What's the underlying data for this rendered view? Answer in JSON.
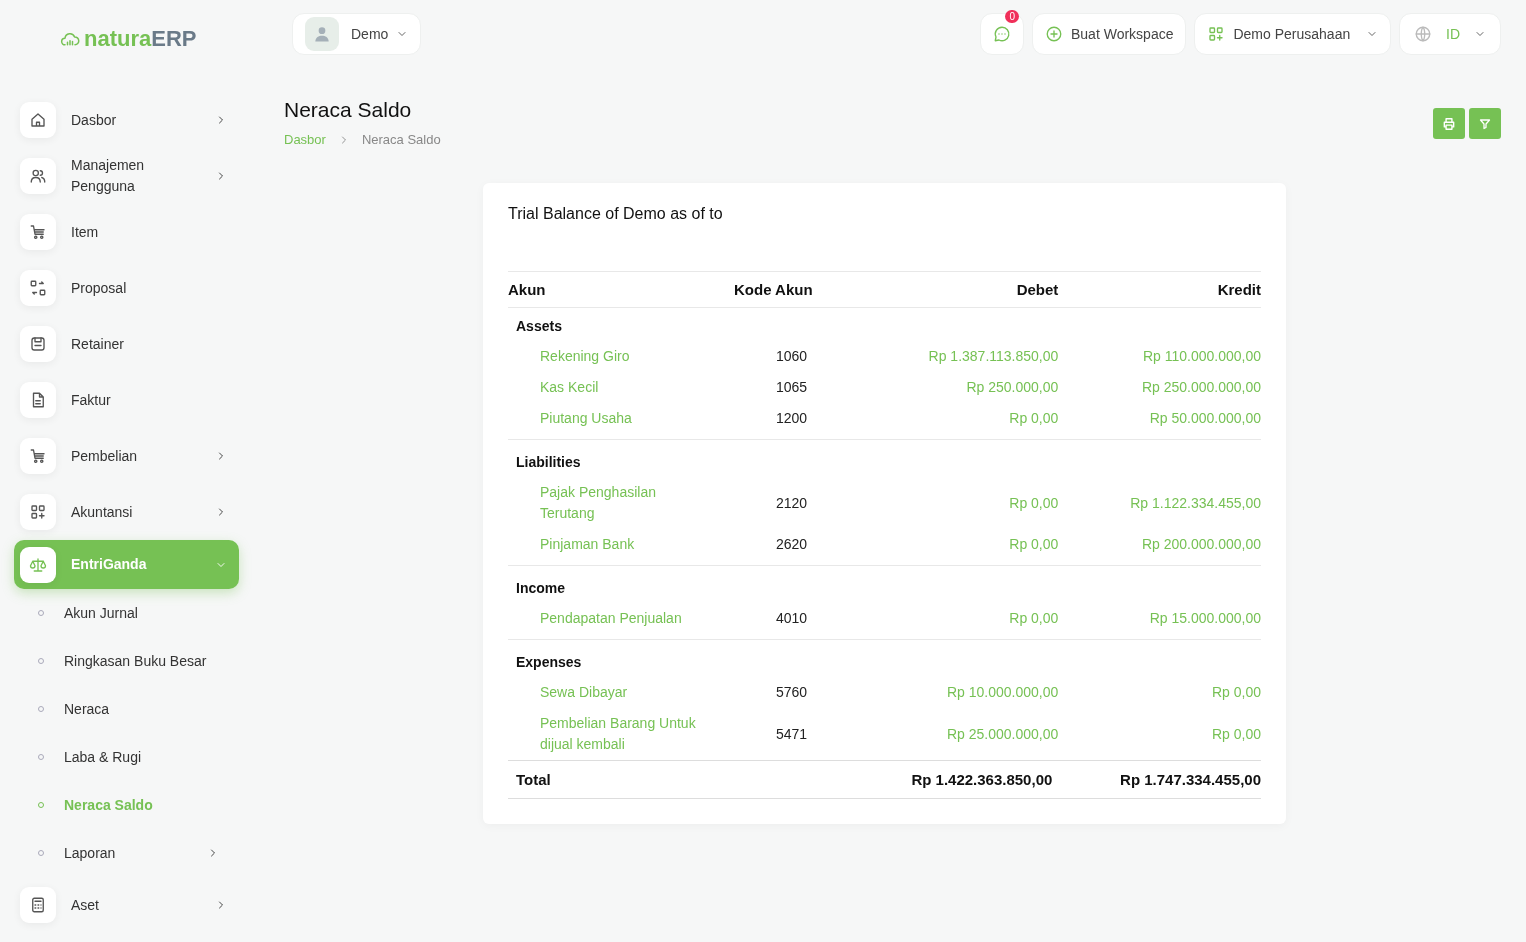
{
  "logo": {
    "part1": "natura",
    "part2": "ERP"
  },
  "user_menu": {
    "label": "Demo"
  },
  "topbar": {
    "notification_count": "0",
    "workspace_button": "Buat Workspace",
    "company": "Demo Perusahaan",
    "language": "ID"
  },
  "sidebar": {
    "items": [
      {
        "label": "Dasbor",
        "has_submenu": true,
        "expanded": false,
        "selected": false
      },
      {
        "label": "Manajemen Pengguna",
        "has_submenu": true,
        "expanded": false,
        "selected": false
      },
      {
        "label": "Item",
        "has_submenu": false,
        "selected": false
      },
      {
        "label": "Proposal",
        "has_submenu": false,
        "selected": false
      },
      {
        "label": "Retainer",
        "has_submenu": false,
        "selected": false
      },
      {
        "label": "Faktur",
        "has_submenu": false,
        "selected": false
      },
      {
        "label": "Pembelian",
        "has_submenu": true,
        "expanded": false,
        "selected": false
      },
      {
        "label": "Akuntansi",
        "has_submenu": true,
        "expanded": false,
        "selected": false
      },
      {
        "label": "EntriGanda",
        "has_submenu": true,
        "expanded": true,
        "selected": true,
        "children": [
          {
            "label": "Akun Jurnal",
            "selected": false,
            "has_submenu": false
          },
          {
            "label": "Ringkasan Buku Besar",
            "selected": false,
            "has_submenu": false
          },
          {
            "label": "Neraca",
            "selected": false,
            "has_submenu": false
          },
          {
            "label": "Laba & Rugi",
            "selected": false,
            "has_submenu": false
          },
          {
            "label": "Neraca Saldo",
            "selected": true,
            "has_submenu": false
          },
          {
            "label": "Laporan",
            "selected": false,
            "has_submenu": true
          }
        ]
      },
      {
        "label": "Aset",
        "has_submenu": true,
        "expanded": false,
        "selected": false
      }
    ]
  },
  "page": {
    "title": "Neraca Saldo",
    "breadcrumb": [
      "Dasbor",
      "Neraca Saldo"
    ]
  },
  "report": {
    "title": "Trial Balance of Demo as of to",
    "columns": [
      "Akun",
      "Kode Akun",
      "Debet",
      "Kredit"
    ],
    "groups": [
      {
        "name": "Assets",
        "rows": [
          {
            "account": "Rekening Giro",
            "code": "1060",
            "debit": "Rp 1.387.113.850,00",
            "credit": "Rp 110.000.000,00"
          },
          {
            "account": "Kas Kecil",
            "code": "1065",
            "debit": "Rp 250.000,00",
            "credit": "Rp 250.000.000,00"
          },
          {
            "account": "Piutang Usaha",
            "code": "1200",
            "debit": "Rp 0,00",
            "credit": "Rp 50.000.000,00"
          }
        ]
      },
      {
        "name": "Liabilities",
        "rows": [
          {
            "account": "Pajak Penghasilan Terutang",
            "code": "2120",
            "debit": "Rp 0,00",
            "credit": "Rp 1.122.334.455,00"
          },
          {
            "account": "Pinjaman Bank",
            "code": "2620",
            "debit": "Rp 0,00",
            "credit": "Rp 200.000.000,00"
          }
        ]
      },
      {
        "name": "Income",
        "rows": [
          {
            "account": "Pendapatan Penjualan",
            "code": "4010",
            "debit": "Rp 0,00",
            "credit": "Rp 15.000.000,00"
          }
        ]
      },
      {
        "name": "Expenses",
        "rows": [
          {
            "account": "Sewa Dibayar",
            "code": "5760",
            "debit": "Rp 10.000.000,00",
            "credit": "Rp 0,00"
          },
          {
            "account": "Pembelian Barang Untuk dijual kembali",
            "code": "5471",
            "debit": "Rp 25.000.000,00",
            "credit": "Rp 0,00"
          }
        ]
      }
    ],
    "total": {
      "label": "Total",
      "debit": "Rp 1.422.363.850,00",
      "credit": "Rp 1.747.334.455,00"
    }
  }
}
